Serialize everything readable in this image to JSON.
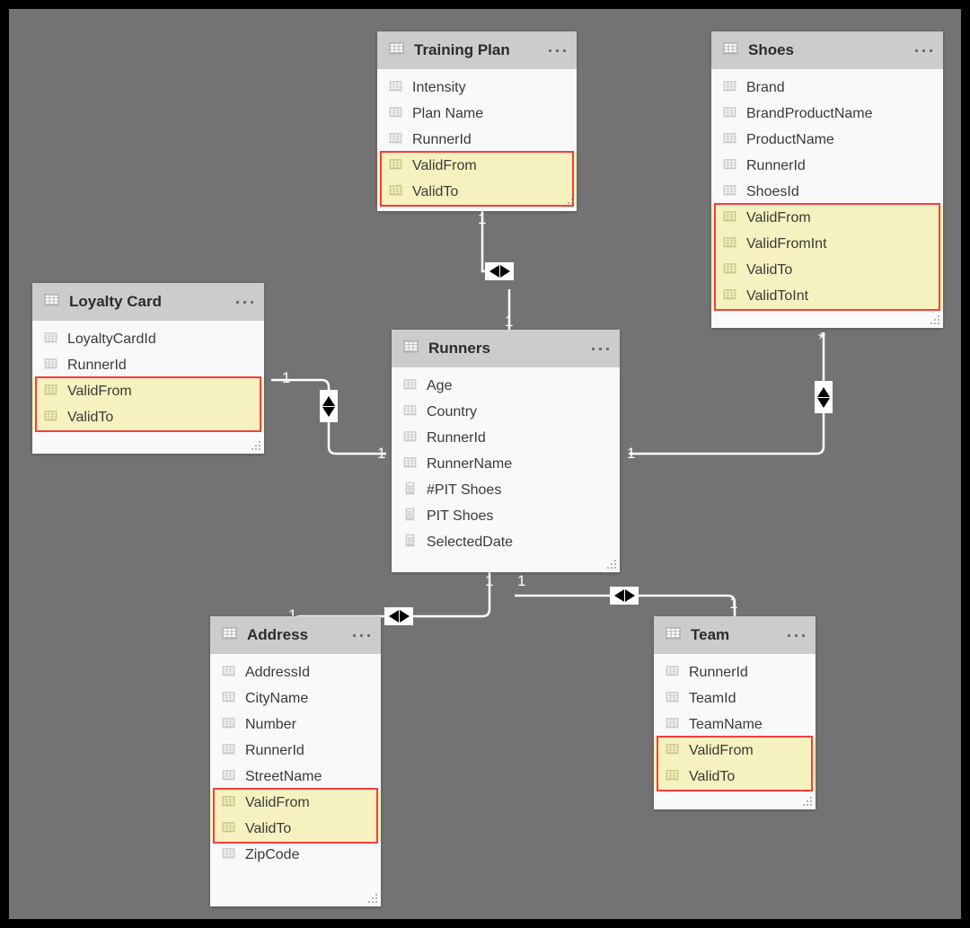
{
  "canvas": {
    "background": "#737373",
    "frame_color": "#000000",
    "highlight_fill": "#f6f2bf",
    "highlight_border": "#fb3b3b",
    "header_fill": "#cccccc",
    "card_fill": "#f9f9f9",
    "relationship_line_color": "#ffffff"
  },
  "tables": [
    {
      "id": "training-plan",
      "name": "Training Plan",
      "menu": "…",
      "fields": [
        {
          "label": "Intensity",
          "icon": "column-icon",
          "highlighted": false
        },
        {
          "label": "Plan Name",
          "icon": "column-icon",
          "highlighted": false
        },
        {
          "label": "RunnerId",
          "icon": "column-icon",
          "highlighted": false
        },
        {
          "label": "ValidFrom",
          "icon": "column-icon",
          "highlighted": true
        },
        {
          "label": "ValidTo",
          "icon": "column-icon",
          "highlighted": true
        }
      ]
    },
    {
      "id": "shoes",
      "name": "Shoes",
      "menu": "…",
      "fields": [
        {
          "label": "Brand",
          "icon": "column-icon",
          "highlighted": false
        },
        {
          "label": "BrandProductName",
          "icon": "column-icon",
          "highlighted": false
        },
        {
          "label": "ProductName",
          "icon": "column-icon",
          "highlighted": false
        },
        {
          "label": "RunnerId",
          "icon": "column-icon",
          "highlighted": false
        },
        {
          "label": "ShoesId",
          "icon": "column-icon",
          "highlighted": false
        },
        {
          "label": "ValidFrom",
          "icon": "column-icon",
          "highlighted": true
        },
        {
          "label": "ValidFromInt",
          "icon": "column-icon",
          "highlighted": true
        },
        {
          "label": "ValidTo",
          "icon": "column-icon",
          "highlighted": true
        },
        {
          "label": "ValidToInt",
          "icon": "column-icon",
          "highlighted": true
        }
      ]
    },
    {
      "id": "loyalty-card",
      "name": "Loyalty Card",
      "menu": "…",
      "fields": [
        {
          "label": "LoyaltyCardId",
          "icon": "column-icon",
          "highlighted": false
        },
        {
          "label": "RunnerId",
          "icon": "column-icon",
          "highlighted": false
        },
        {
          "label": "ValidFrom",
          "icon": "column-icon",
          "highlighted": true
        },
        {
          "label": "ValidTo",
          "icon": "column-icon",
          "highlighted": true
        }
      ]
    },
    {
      "id": "runners",
      "name": "Runners",
      "menu": "…",
      "fields": [
        {
          "label": "Age",
          "icon": "column-icon",
          "highlighted": false
        },
        {
          "label": "Country",
          "icon": "column-icon",
          "highlighted": false
        },
        {
          "label": "RunnerId",
          "icon": "column-icon",
          "highlighted": false
        },
        {
          "label": "RunnerName",
          "icon": "column-icon",
          "highlighted": false
        },
        {
          "label": "#PIT Shoes",
          "icon": "measure-icon",
          "highlighted": false
        },
        {
          "label": "PIT Shoes",
          "icon": "measure-icon",
          "highlighted": false
        },
        {
          "label": "SelectedDate",
          "icon": "measure-icon",
          "highlighted": false
        }
      ]
    },
    {
      "id": "address",
      "name": "Address",
      "menu": "…",
      "fields": [
        {
          "label": "AddressId",
          "icon": "column-icon",
          "highlighted": false
        },
        {
          "label": "CityName",
          "icon": "column-icon",
          "highlighted": false
        },
        {
          "label": "Number",
          "icon": "column-icon",
          "highlighted": false
        },
        {
          "label": "RunnerId",
          "icon": "column-icon",
          "highlighted": false
        },
        {
          "label": "StreetName",
          "icon": "column-icon",
          "highlighted": false
        },
        {
          "label": "ValidFrom",
          "icon": "column-icon",
          "highlighted": true
        },
        {
          "label": "ValidTo",
          "icon": "column-icon",
          "highlighted": true
        },
        {
          "label": "ZipCode",
          "icon": "column-icon",
          "highlighted": false
        }
      ]
    },
    {
      "id": "team",
      "name": "Team",
      "menu": "…",
      "fields": [
        {
          "label": "RunnerId",
          "icon": "column-icon",
          "highlighted": false
        },
        {
          "label": "TeamId",
          "icon": "column-icon",
          "highlighted": false
        },
        {
          "label": "TeamName",
          "icon": "column-icon",
          "highlighted": false
        },
        {
          "label": "ValidFrom",
          "icon": "column-icon",
          "highlighted": true
        },
        {
          "label": "ValidTo",
          "icon": "column-icon",
          "highlighted": true
        }
      ]
    }
  ],
  "relationships": [
    {
      "id": "training-plan-runners",
      "from_table": "Training Plan",
      "to_table": "Runners",
      "from_cardinality": "1",
      "to_cardinality": "1",
      "cross_filter": "both",
      "arrow_orientation": "horizontal"
    },
    {
      "id": "loyalty-card-runners",
      "from_table": "Loyalty Card",
      "to_table": "Runners",
      "from_cardinality": "1",
      "to_cardinality": "1",
      "cross_filter": "both",
      "arrow_orientation": "vertical"
    },
    {
      "id": "shoes-runners",
      "from_table": "Shoes",
      "to_table": "Runners",
      "from_cardinality": "*",
      "to_cardinality": "1",
      "cross_filter": "both",
      "arrow_orientation": "vertical"
    },
    {
      "id": "runners-address",
      "from_table": "Runners",
      "to_table": "Address",
      "from_cardinality": "1",
      "to_cardinality": "1",
      "cross_filter": "both",
      "arrow_orientation": "horizontal"
    },
    {
      "id": "runners-team",
      "from_table": "Runners",
      "to_table": "Team",
      "from_cardinality": "1",
      "to_cardinality": "1",
      "cross_filter": "both",
      "arrow_orientation": "horizontal"
    }
  ],
  "cardinality_labels": {
    "training_plan_end": "1",
    "runners_top_end": "1",
    "loyalty_card_end": "1",
    "runners_left_end": "1",
    "shoes_end": "*",
    "runners_right_end": "1",
    "runners_bottom_left_end": "1",
    "address_end": "1",
    "runners_bottom_right_end": "1",
    "team_end": "1"
  }
}
